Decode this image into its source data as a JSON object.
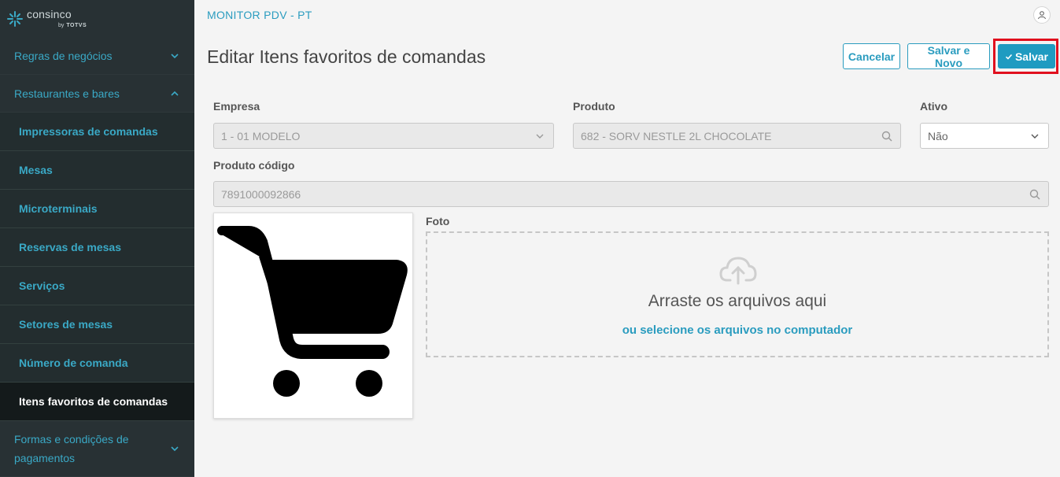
{
  "sidebar": {
    "logo": {
      "name": "consinco",
      "by": "by",
      "partner": "TOTVS"
    },
    "groups": [
      {
        "label": "Regras de negócios",
        "expanded": false
      },
      {
        "label": "Restaurantes e bares",
        "expanded": true
      }
    ],
    "items": [
      {
        "label": "Impressoras de comandas"
      },
      {
        "label": "Mesas"
      },
      {
        "label": "Microterminais"
      },
      {
        "label": "Reservas de mesas"
      },
      {
        "label": "Serviços"
      },
      {
        "label": "Setores de mesas"
      },
      {
        "label": "Número de comanda"
      },
      {
        "label": "Itens favoritos de comandas",
        "active": true
      }
    ],
    "bottom_group": {
      "line1": "Formas e condições de",
      "line2": "pagamentos"
    }
  },
  "header": {
    "app_title": "MONITOR PDV - PT",
    "page_title": "Editar Itens favoritos de comandas"
  },
  "toolbar": {
    "cancel_label": "Cancelar",
    "save_new_label": "Salvar e Novo",
    "save_label": "Salvar"
  },
  "form": {
    "empresa": {
      "label": "Empresa",
      "value": "1 - 01 MODELO"
    },
    "produto": {
      "label": "Produto",
      "value": "682 - SORV NESTLE 2L CHOCOLATE"
    },
    "ativo": {
      "label": "Ativo",
      "value": "Não"
    },
    "produto_codigo": {
      "label": "Produto código",
      "value": "7891000092866"
    },
    "foto": {
      "label": "Foto",
      "drop_text": "Arraste os arquivos aqui",
      "select_link": "ou selecione os arquivos no computador"
    }
  },
  "colors": {
    "accent": "#2a9cbf",
    "sidebar_bg": "#1d2426",
    "highlight": "#e0101e"
  }
}
